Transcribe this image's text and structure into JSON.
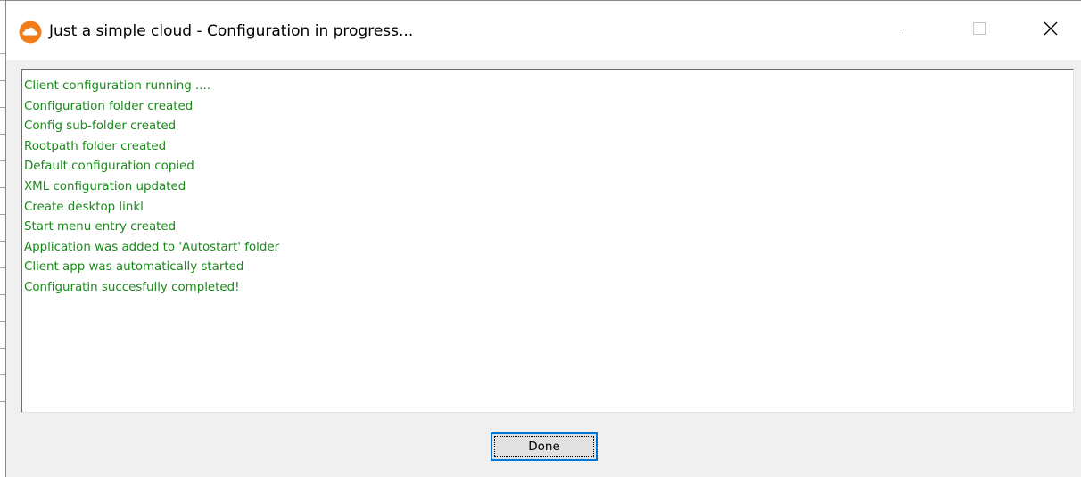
{
  "window": {
    "title": "Just a simple cloud - Configuration in progress...",
    "app_icon": "cloud-app-icon",
    "controls": {
      "minimize_icon": "minimize-icon",
      "maximize_icon": "maximize-icon",
      "close_icon": "close-icon"
    }
  },
  "log": {
    "color": "#1a8a1a",
    "lines": [
      "Client configuration running ....",
      "Configuration folder created",
      "Config sub-folder created",
      "Rootpath folder created",
      "Default configuration copied",
      "XML configuration updated",
      "Create desktop linkl",
      "Start menu entry created",
      "Application was added to 'Autostart' folder",
      "Client app was automatically started",
      "Configuratin succesfully completed!"
    ]
  },
  "footer": {
    "done_label": "Done"
  },
  "colors": {
    "accent": "#0078d7",
    "icon_orange": "#f07c1a",
    "window_bg": "#f0f0f0"
  }
}
